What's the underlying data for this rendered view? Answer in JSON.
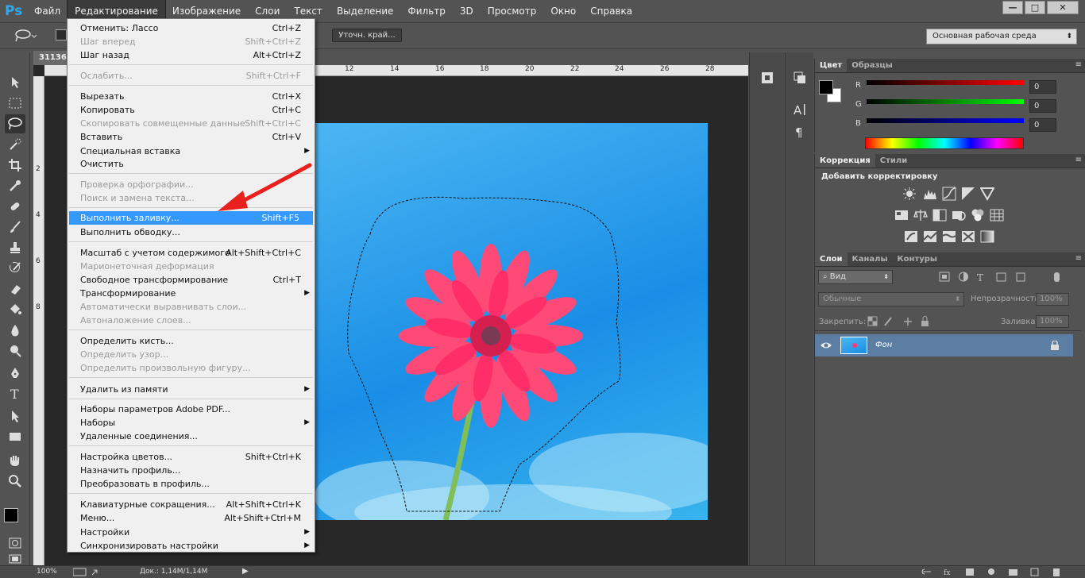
{
  "app": {
    "logo": "Ps"
  },
  "menubar": [
    "Файл",
    "Редактирование",
    "Изображение",
    "Слои",
    "Текст",
    "Выделение",
    "Фильтр",
    "3D",
    "Просмотр",
    "Окно",
    "Справка"
  ],
  "window_controls": {
    "minimize": "—",
    "maximize": "□",
    "close": "✕"
  },
  "options": {
    "refine_edge": "Уточн. край...",
    "workspace": "Основная рабочая среда"
  },
  "document": {
    "tab": "31136.",
    "ruler_top": [
      "12",
      "14",
      "16",
      "18",
      "20",
      "22",
      "24",
      "26",
      "28"
    ],
    "ruler_left": [
      "2",
      "4",
      "6",
      "8"
    ]
  },
  "status": {
    "zoom": "100%",
    "doc": "Док.: 1,14M/1,14M"
  },
  "edit_menu": [
    {
      "label": "Отменить: Лассо",
      "shortcut": "Ctrl+Z"
    },
    {
      "label": "Шаг вперед",
      "shortcut": "Shift+Ctrl+Z",
      "disabled": true
    },
    {
      "label": "Шаг назад",
      "shortcut": "Alt+Ctrl+Z"
    },
    {
      "label": "Ослабить...",
      "shortcut": "Shift+Ctrl+F",
      "disabled": true
    },
    {
      "label": "Вырезать",
      "shortcut": "Ctrl+X"
    },
    {
      "label": "Копировать",
      "shortcut": "Ctrl+C"
    },
    {
      "label": "Скопировать совмещенные данные",
      "shortcut": "Shift+Ctrl+C",
      "disabled": true
    },
    {
      "label": "Вставить",
      "shortcut": "Ctrl+V"
    },
    {
      "label": "Специальная вставка",
      "submenu": true
    },
    {
      "label": "Очистить"
    },
    {
      "label": "Проверка орфографии...",
      "disabled": true
    },
    {
      "label": "Поиск и замена текста...",
      "disabled": true
    },
    {
      "label": "Выполнить заливку...",
      "shortcut": "Shift+F5",
      "highlighted": true
    },
    {
      "label": "Выполнить обводку..."
    },
    {
      "label": "Масштаб с учетом содержимого",
      "shortcut": "Alt+Shift+Ctrl+C"
    },
    {
      "label": "Марионеточная деформация",
      "disabled": true
    },
    {
      "label": "Свободное трансформирование",
      "shortcut": "Ctrl+T"
    },
    {
      "label": "Трансформирование",
      "submenu": true
    },
    {
      "label": "Автоматически выравнивать слои...",
      "disabled": true
    },
    {
      "label": "Автоналожение слоев...",
      "disabled": true
    },
    {
      "label": "Определить кисть..."
    },
    {
      "label": "Определить узор...",
      "disabled": true
    },
    {
      "label": "Определить произвольную фигуру...",
      "disabled": true
    },
    {
      "label": "Удалить из памяти",
      "submenu": true
    },
    {
      "label": "Наборы параметров Adobe PDF..."
    },
    {
      "label": "Наборы",
      "submenu": true
    },
    {
      "label": "Удаленные соединения..."
    },
    {
      "label": "Настройка цветов...",
      "shortcut": "Shift+Ctrl+K"
    },
    {
      "label": "Назначить профиль..."
    },
    {
      "label": "Преобразовать в профиль..."
    },
    {
      "label": "Клавиатурные сокращения...",
      "shortcut": "Alt+Shift+Ctrl+K"
    },
    {
      "label": "Меню...",
      "shortcut": "Alt+Shift+Ctrl+M"
    },
    {
      "label": "Настройки",
      "submenu": true
    },
    {
      "label": "Синхронизировать настройки",
      "submenu": true
    }
  ],
  "color_panel": {
    "tabs": [
      "Цвет",
      "Образцы"
    ],
    "r_label": "R",
    "g_label": "G",
    "b_label": "B",
    "r": "0",
    "g": "0",
    "b": "0"
  },
  "adjust_panel": {
    "tabs": [
      "Коррекция",
      "Стили"
    ],
    "title": "Добавить корректировку"
  },
  "layers_panel": {
    "tabs": [
      "Слои",
      "Каналы",
      "Контуры"
    ],
    "filter": "Вид",
    "blend_mode": "Обычные",
    "opacity_label": "Непрозрачность:",
    "opacity": "100%",
    "lock_label": "Закрепить:",
    "fill_label": "Заливка:",
    "fill": "100%",
    "layer_name": "Фон"
  },
  "colors": {
    "accent": "#3399ff",
    "layer_selected": "#5d7ea3",
    "ps_logo": "#32a8e8"
  }
}
